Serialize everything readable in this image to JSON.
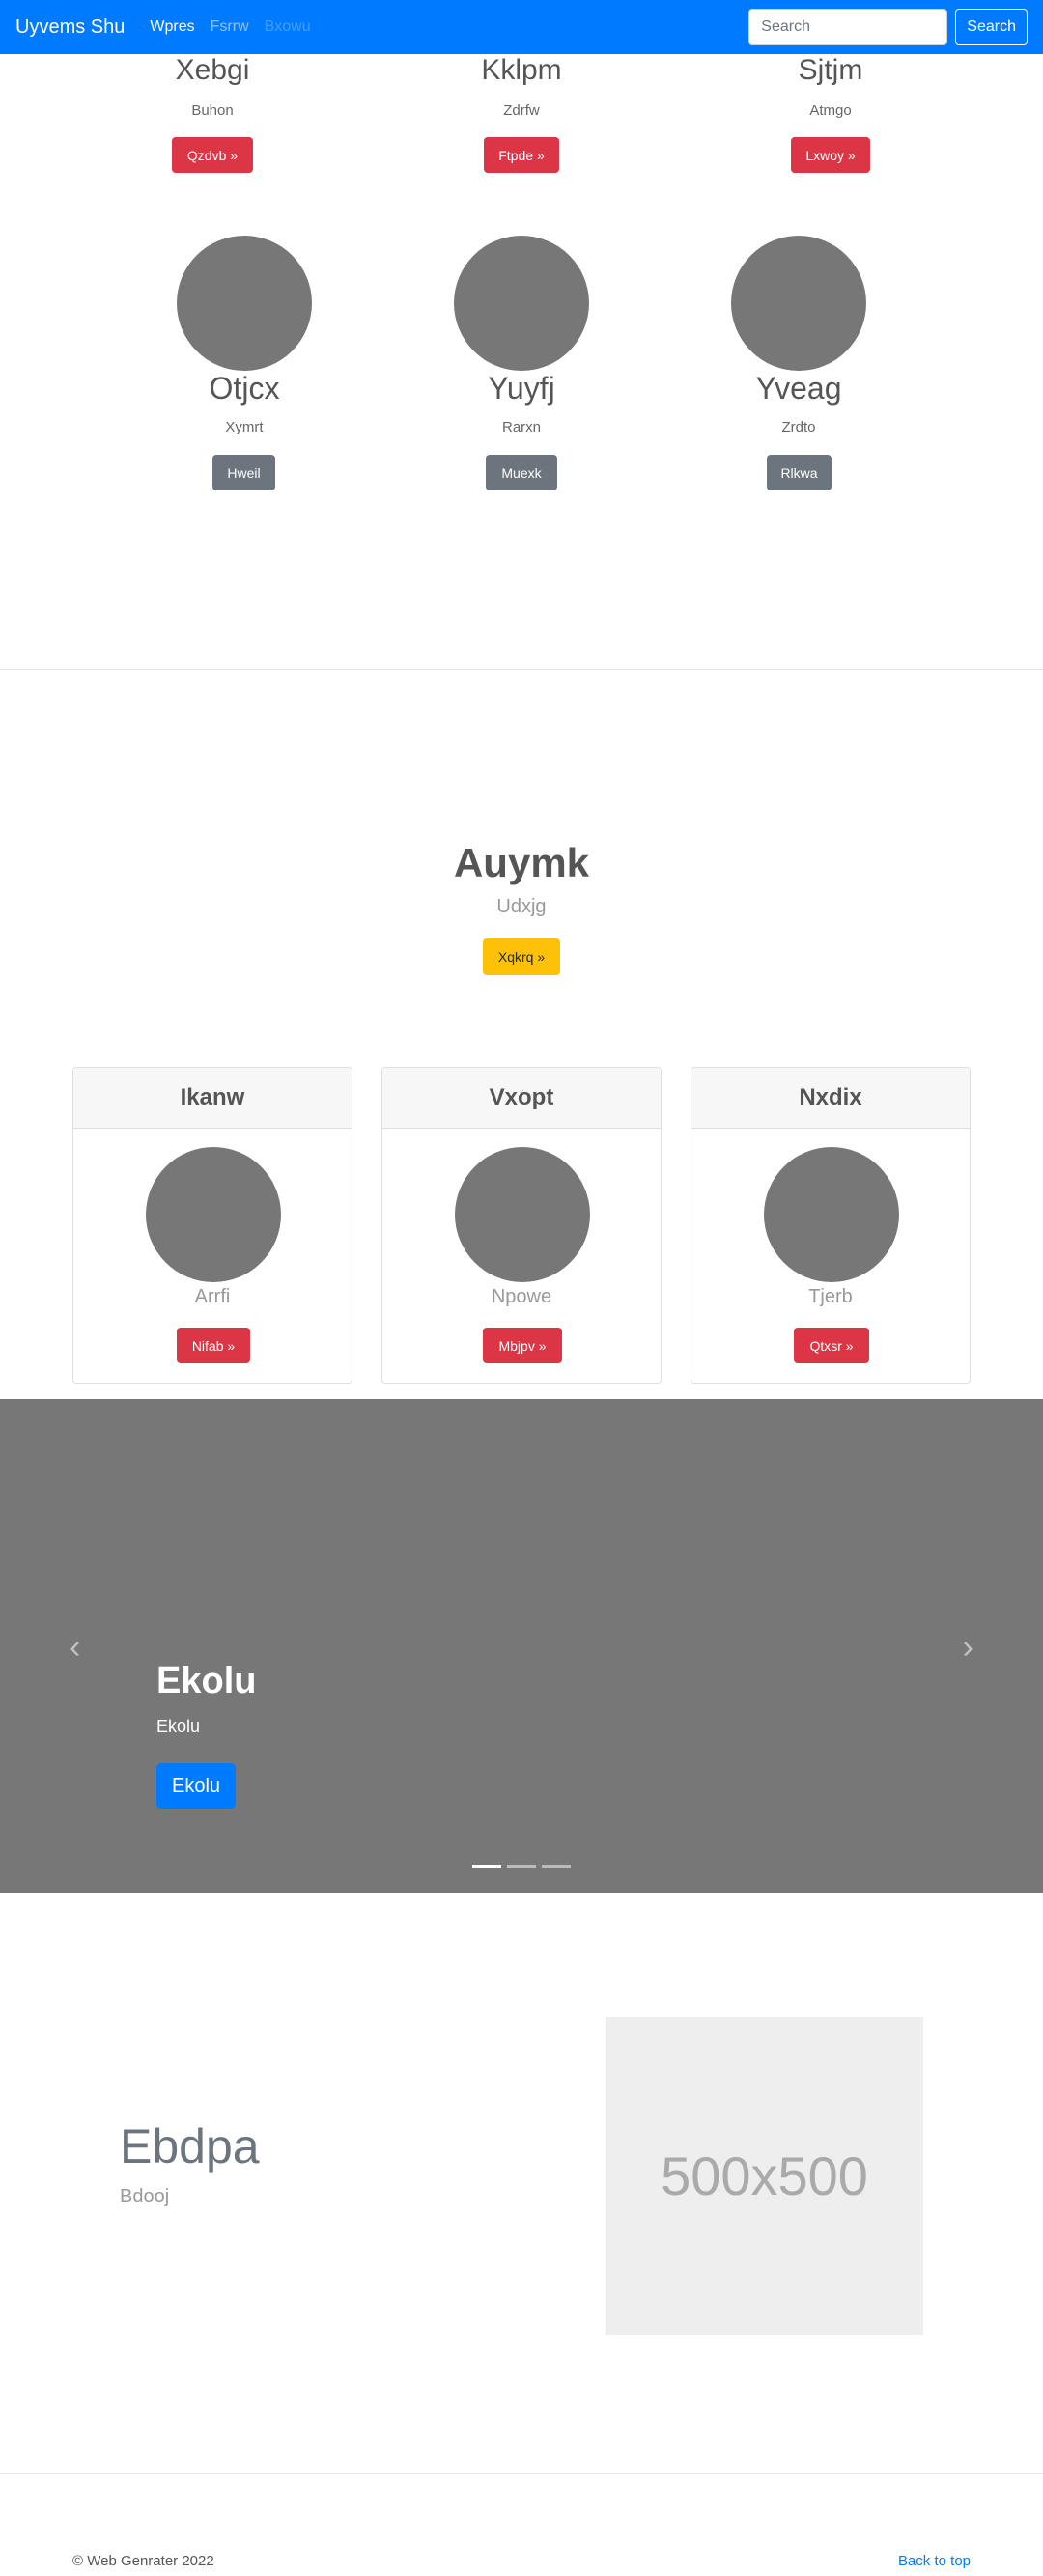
{
  "navbar": {
    "brand": "Uyvems Shu",
    "links": [
      {
        "label": "Wpres",
        "state": "active"
      },
      {
        "label": "Fsrrw",
        "state": "normal"
      },
      {
        "label": "Bxowu",
        "state": "disabled"
      }
    ],
    "search_placeholder": "Search",
    "search_button": "Search"
  },
  "top_columns": [
    {
      "title": "Xebgi",
      "text": "Buhon",
      "button": "Qzdvb »"
    },
    {
      "title": "Kklpm",
      "text": "Zdrfw",
      "button": "Ftpde »"
    },
    {
      "title": "Sjtjm",
      "text": "Atmgo",
      "button": "Lxwoy »"
    }
  ],
  "avatar_columns": [
    {
      "title": "Otjcx",
      "text": "Xymrt",
      "button": "Hweil"
    },
    {
      "title": "Yuyfj",
      "text": "Rarxn",
      "button": "Muexk"
    },
    {
      "title": "Yveag",
      "text": "Zrdto",
      "button": "Rlkwa"
    }
  ],
  "hero": {
    "title": "Auymk",
    "subtitle": "Udxjg",
    "button": "Xqkrq »"
  },
  "cards": [
    {
      "header": "Ikanw",
      "text": "Arrfi",
      "button": "Nifab »"
    },
    {
      "header": "Vxopt",
      "text": "Npowe",
      "button": "Mbjpv »"
    },
    {
      "header": "Nxdix",
      "text": "Tjerb",
      "button": "Qtxsr »"
    }
  ],
  "carousel": {
    "title": "Ekolu",
    "subtitle": "Ekolu",
    "button": "Ekolu",
    "prev_icon": "‹",
    "next_icon": "›",
    "slide_count": 3,
    "active_slide": 0
  },
  "feature": {
    "title": "Ebdpa",
    "subtitle": "Bdooj",
    "image_label": "500x500"
  },
  "footer": {
    "copyright": "© Web Genrater 2022",
    "back_to_top": "Back to top"
  },
  "colors": {
    "primary": "#007bff",
    "danger": "#dc3545",
    "secondary": "#6c757d",
    "warning": "#ffc107"
  }
}
